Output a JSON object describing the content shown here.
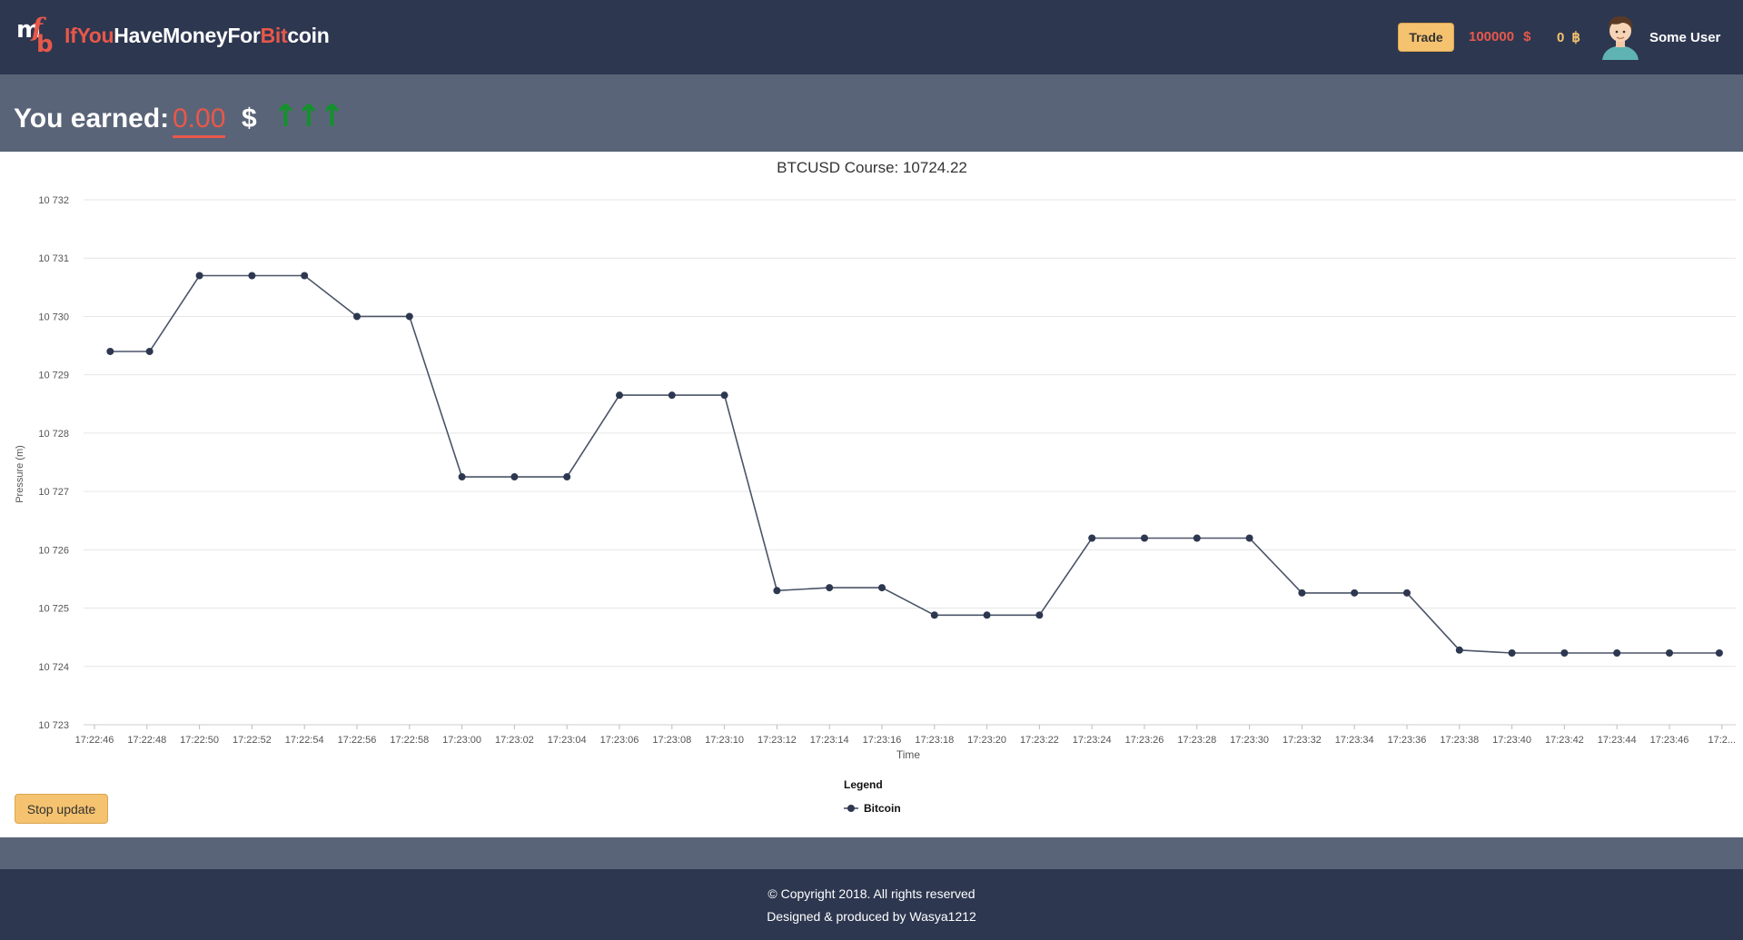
{
  "header": {
    "brand_segments": [
      {
        "text": "IfYou",
        "color": "red"
      },
      {
        "text": "Have",
        "color": "white"
      },
      {
        "text": "Money",
        "color": "white"
      },
      {
        "text": "For",
        "color": "white"
      },
      {
        "text": "Bit",
        "color": "red"
      },
      {
        "text": "coin",
        "color": "white"
      }
    ],
    "logo_letters": {
      "m": "m",
      "f": "f",
      "b": "b"
    },
    "trade_label": "Trade",
    "balance_usd": "100000",
    "usd_symbol": "$",
    "balance_btc": "0",
    "btc_symbol": "฿",
    "user_name": "Some User"
  },
  "earned": {
    "label": "You earned:",
    "value": "0.00",
    "currency": "$",
    "trend": "↑↑↑"
  },
  "chart_data": {
    "type": "line",
    "title": "BTCUSD Course: 10724.22",
    "xlabel": "Time",
    "ylabel": "Pressure (m)",
    "ylim": [
      10723,
      10732
    ],
    "y_ticks": [
      "10 723",
      "10 724",
      "10 725",
      "10 726",
      "10 727",
      "10 728",
      "10 729",
      "10 730",
      "10 731",
      "10 732"
    ],
    "x_ticks": [
      "17:22:46",
      "17:22:48",
      "17:22:50",
      "17:22:52",
      "17:22:54",
      "17:22:56",
      "17:22:58",
      "17:23:00",
      "17:23:02",
      "17:23:04",
      "17:23:06",
      "17:23:08",
      "17:23:10",
      "17:23:12",
      "17:23:14",
      "17:23:16",
      "17:23:18",
      "17:23:20",
      "17:23:22",
      "17:23:24",
      "17:23:26",
      "17:23:28",
      "17:23:30",
      "17:23:32",
      "17:23:34",
      "17:23:36",
      "17:23:38",
      "17:23:40",
      "17:23:42",
      "17:23:44",
      "17:23:46",
      "17:2..."
    ],
    "grid": true,
    "legend_title": "Legend",
    "legend_position": "bottom-center",
    "series": [
      {
        "name": "Bitcoin",
        "color": "#2d3750",
        "x": [
          "17:22:46.6",
          "17:22:48.1",
          "17:22:50.0",
          "17:22:52.0",
          "17:22:54.0",
          "17:22:56.0",
          "17:22:58.0",
          "17:23:00.0",
          "17:23:02.0",
          "17:23:04.0",
          "17:23:06.0",
          "17:23:08.0",
          "17:23:10.0",
          "17:23:12.0",
          "17:23:14.0",
          "17:23:16.0",
          "17:23:18.0",
          "17:23:20.0",
          "17:23:22.0",
          "17:23:24.0",
          "17:23:26.0",
          "17:23:28.0",
          "17:23:30.0",
          "17:23:32.0",
          "17:23:34.0",
          "17:23:36.0",
          "17:23:38.0",
          "17:23:40.0",
          "17:23:42.0",
          "17:23:44.0",
          "17:23:46.0",
          "17:23:47.9"
        ],
        "values": [
          10729.4,
          10729.4,
          10730.7,
          10730.7,
          10730.7,
          10730.0,
          10730.0,
          10727.25,
          10727.25,
          10727.25,
          10728.65,
          10728.65,
          10728.65,
          10725.3,
          10725.35,
          10725.35,
          10724.88,
          10724.88,
          10724.88,
          10726.2,
          10726.2,
          10726.2,
          10726.2,
          10725.26,
          10725.26,
          10725.26,
          10724.28,
          10724.23,
          10724.23,
          10724.23,
          10724.23,
          10724.23
        ]
      }
    ]
  },
  "controls": {
    "stop_label": "Stop update"
  },
  "footer": {
    "copyright": "© Copyright 2018. All rights reserved",
    "credits": "Designed & produced by Wasya1212"
  }
}
